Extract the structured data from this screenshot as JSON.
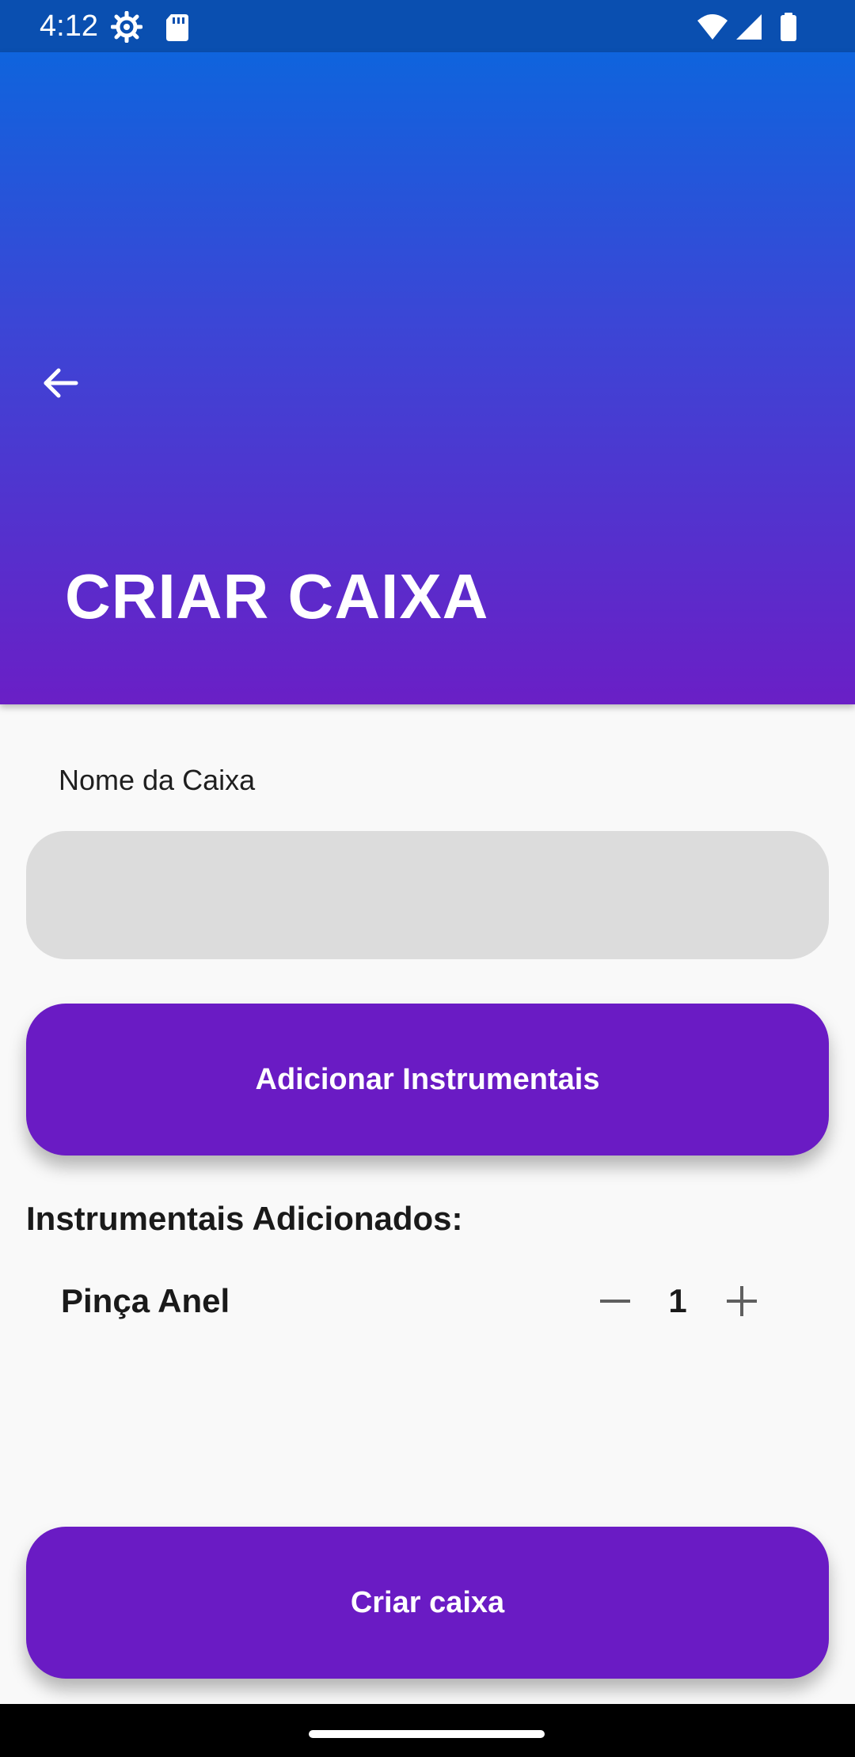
{
  "status_bar": {
    "time": "4:12",
    "icons": [
      "settings-icon",
      "sd-card-icon",
      "wifi-icon",
      "signal-icon",
      "battery-icon"
    ]
  },
  "header": {
    "title": "CRIAR CAIXA",
    "back_icon": "arrow-back-icon",
    "gradient_top": "#0f64dd",
    "gradient_bottom": "#6a1fc6"
  },
  "form": {
    "name_label": "Nome da Caixa",
    "name_value": "",
    "name_placeholder": "",
    "add_button_label": "Adicionar Instrumentais"
  },
  "instruments": {
    "section_title": "Instrumentais Adicionados:",
    "items": [
      {
        "name": "Pinça Anel",
        "quantity": "1"
      }
    ]
  },
  "footer": {
    "create_button_label": "Criar caixa"
  },
  "colors": {
    "accent": "#6a1bc4",
    "input_bg": "#dcdcdc",
    "background": "#f9f9f9"
  }
}
